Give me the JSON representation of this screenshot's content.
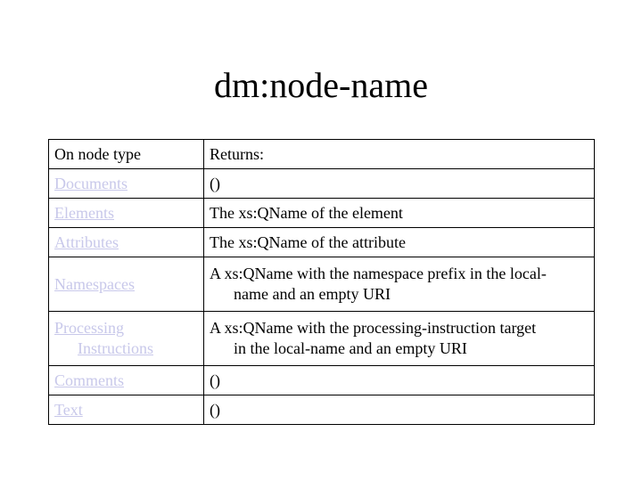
{
  "slide": {
    "title": "dm:node-name",
    "table": {
      "headers": [
        "On node type",
        "Returns:"
      ],
      "rows": [
        {
          "node_type": "Documents",
          "returns": "()"
        },
        {
          "node_type": "Elements",
          "returns": "The xs:QName of the element"
        },
        {
          "node_type": "Attributes",
          "returns": "The xs:QName of the attribute"
        },
        {
          "node_type": "Namespaces",
          "returns_line1": "A xs:QName with the namespace prefix in the local-",
          "returns_line2": "name and an empty URI"
        },
        {
          "node_type_line1": "Processing",
          "node_type_line2": "Instructions",
          "returns_line1": "A xs:QName with the processing-instruction target",
          "returns_line2": "in the local-name and an empty URI"
        },
        {
          "node_type": "Comments",
          "returns": "()"
        },
        {
          "node_type": "Text",
          "returns": "()"
        }
      ]
    },
    "colors": {
      "link": "#c8c8ea",
      "text": "#000000",
      "background": "#ffffff"
    }
  }
}
